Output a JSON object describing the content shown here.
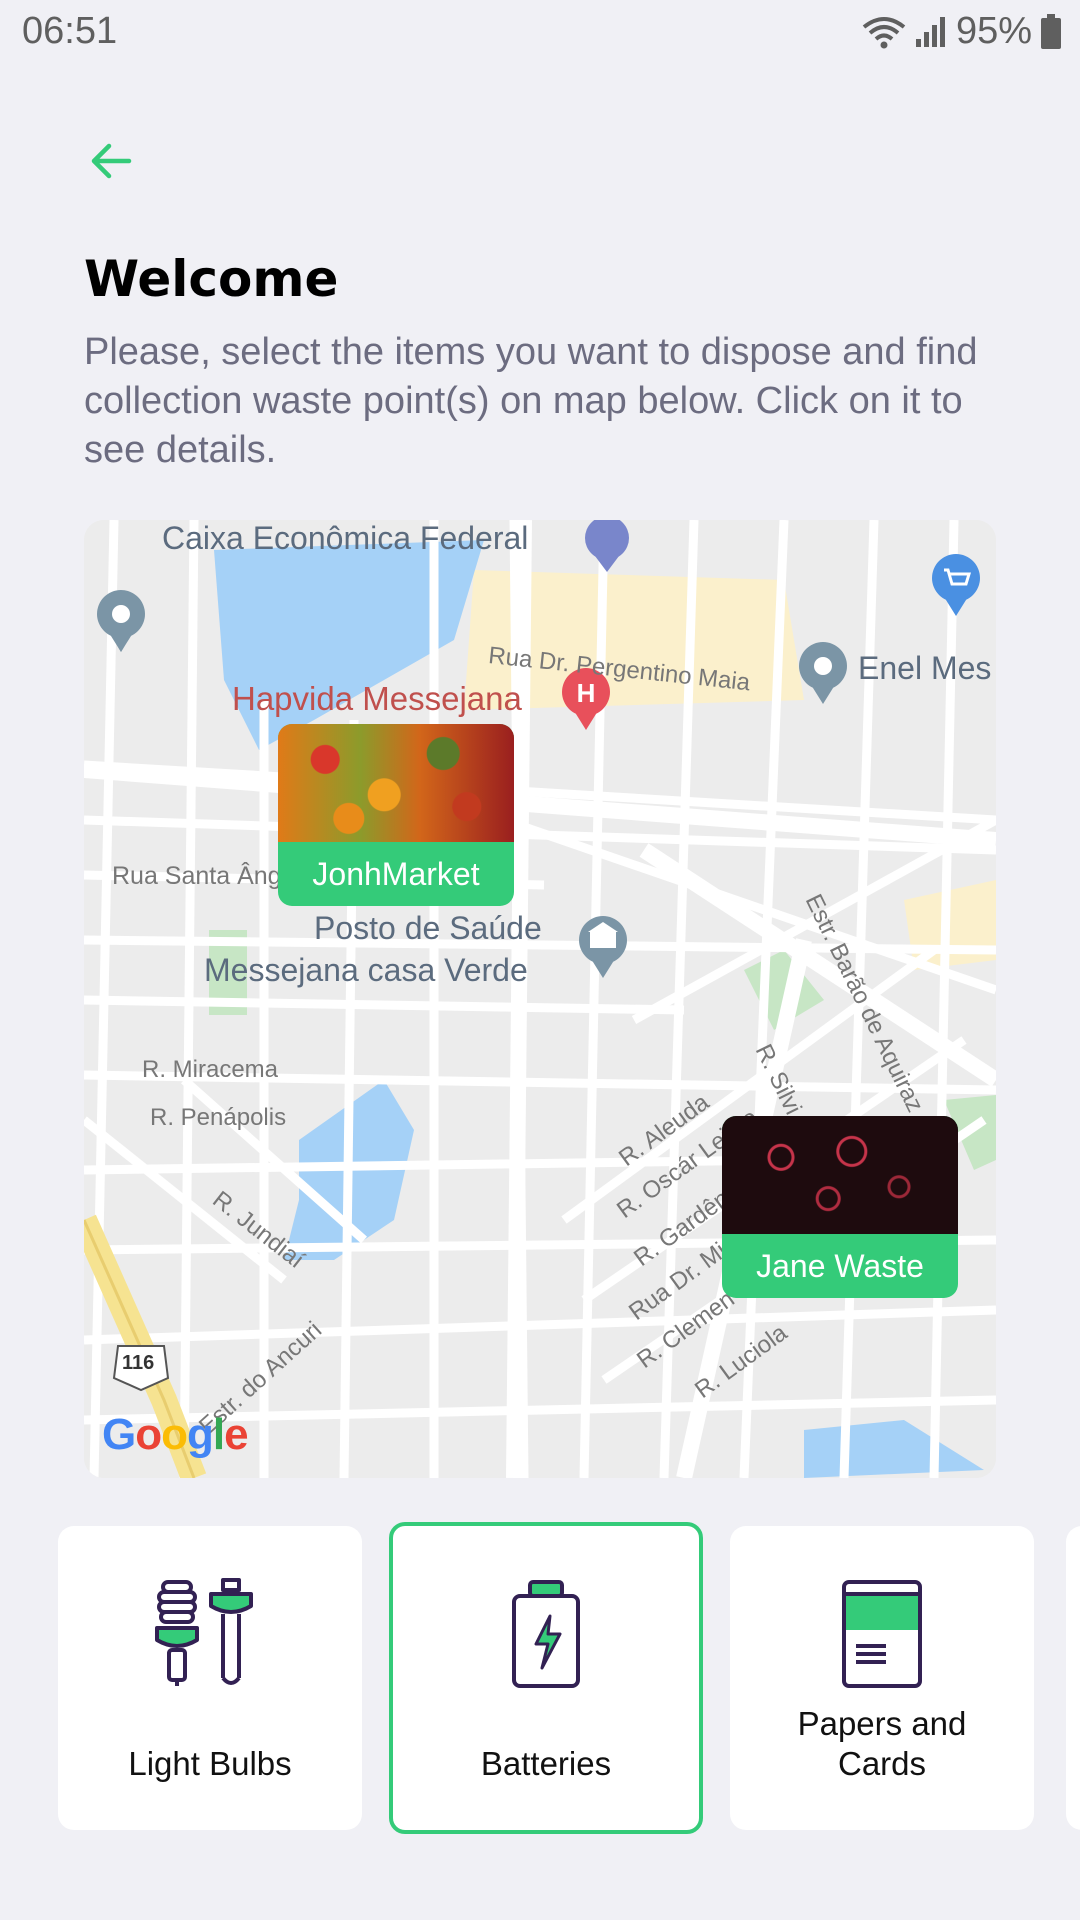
{
  "status_bar": {
    "time": "06:51",
    "battery_percent": "95%"
  },
  "header": {
    "title": "Welcome",
    "description": "Please, select the items you want to dispose and find collection waste point(s) on map below. Click on it to see details."
  },
  "map": {
    "labels": {
      "caixa": "Caixa Econômica Federal",
      "hapvida": "Hapvida Messejana",
      "rua_pergentino": "Rua Dr. Pergentino Maia",
      "enel": "Enel Mes",
      "rua_santa": "Rua Santa Âng",
      "posto_line1": "Posto de Saúde",
      "posto_line2": "Messejana casa Verde",
      "estr_barao": "Estr. Barão de Aquiraz",
      "miracema": "R. Miracema",
      "penapolis": "R. Penápolis",
      "jundiai": "R. Jundiaí",
      "ancuri": "Estr. do Ancuri",
      "aleuda": "R. Aleuda",
      "oscar": "R. Oscár Leitão",
      "gardenia": "R. Gardên",
      "rua_dr_mi": "Rua Dr. Mi",
      "clemen": "R. Clemen",
      "luciola": "R. Luciola",
      "silvio": "R. Silvi",
      "highway": "116",
      "google": "Google"
    },
    "markers": [
      {
        "name": "JonhMarket"
      },
      {
        "name": "Jane Waste"
      }
    ]
  },
  "items": [
    {
      "label": "Light Bulbs",
      "icon": "light-bulbs-icon",
      "selected": false
    },
    {
      "label": "Batteries",
      "icon": "battery-icon",
      "selected": true
    },
    {
      "label_line1": "Papers and",
      "label_line2": "Cards",
      "icon": "paper-cards-icon",
      "selected": false
    }
  ],
  "colors": {
    "accent": "#34cb79",
    "dark": "#322153",
    "background": "#f0f0f5"
  }
}
